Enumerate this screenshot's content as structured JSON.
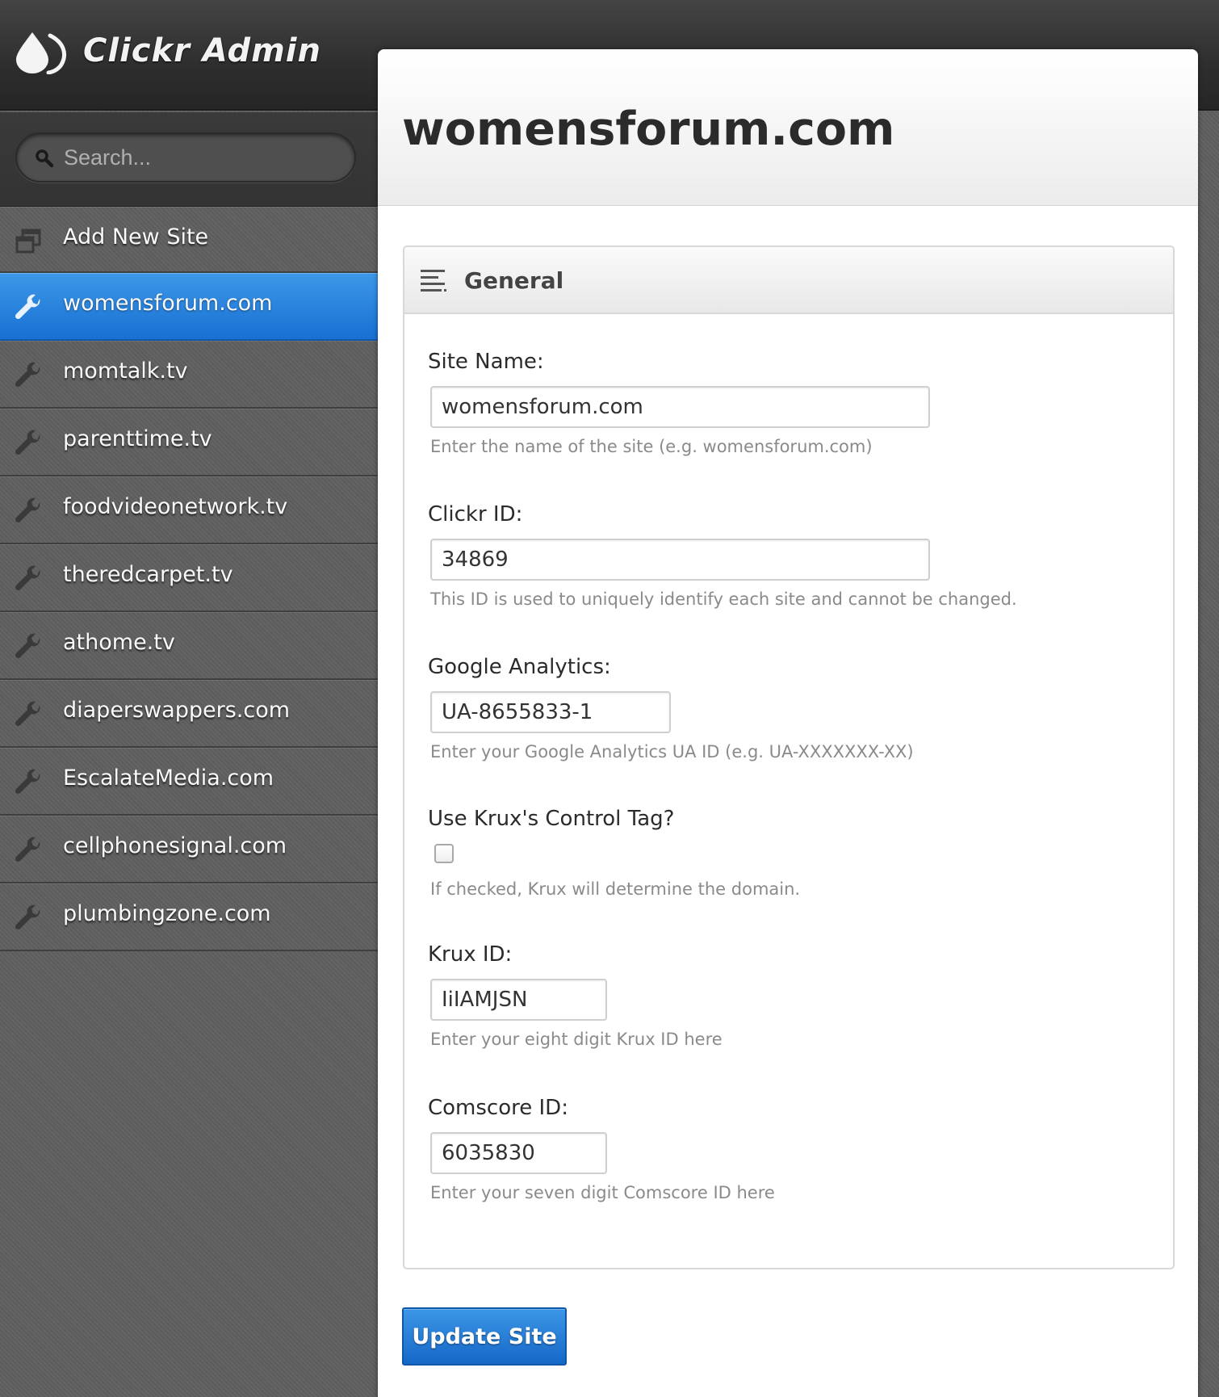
{
  "app": {
    "title": "Clickr Admin",
    "logo_icon": "water-drop-logo-icon"
  },
  "search": {
    "placeholder": "Search...",
    "value": "",
    "icon": "search-icon"
  },
  "sidebar": {
    "add_site": {
      "label": "Add New Site",
      "icon": "add-windows-icon"
    },
    "sites": [
      {
        "label": "womensforum.com",
        "icon": "wrench-icon",
        "active": true
      },
      {
        "label": "momtalk.tv",
        "icon": "wrench-icon",
        "active": false
      },
      {
        "label": "parenttime.tv",
        "icon": "wrench-icon",
        "active": false
      },
      {
        "label": "foodvideonetwork.tv",
        "icon": "wrench-icon",
        "active": false
      },
      {
        "label": "theredcarpet.tv",
        "icon": "wrench-icon",
        "active": false
      },
      {
        "label": "athome.tv",
        "icon": "wrench-icon",
        "active": false
      },
      {
        "label": "diaperswappers.com",
        "icon": "wrench-icon",
        "active": false
      },
      {
        "label": "EscalateMedia.com",
        "icon": "wrench-icon",
        "active": false
      },
      {
        "label": "cellphonesignal.com",
        "icon": "wrench-icon",
        "active": false
      },
      {
        "label": "plumbingzone.com",
        "icon": "wrench-icon",
        "active": false
      }
    ]
  },
  "main": {
    "page_title": "womensforum.com",
    "section": {
      "title": "General",
      "icon": "align-left-lines-icon",
      "fields": {
        "site_name": {
          "label": "Site Name:",
          "value": "womensforum.com",
          "help": "Enter the name of the site (e.g. womensforum.com)"
        },
        "clickr_id": {
          "label": "Clickr ID:",
          "value": "34869",
          "help": "This ID is used to uniquely identify each site and cannot be changed."
        },
        "google_analytics": {
          "label": "Google Analytics:",
          "value": "UA-8655833-1",
          "help": "Enter your Google Analytics UA ID (e.g. UA-XXXXXXX-XX)"
        },
        "krux_control_tag": {
          "label": "Use Krux's Control Tag?",
          "checked": false,
          "help": "If checked, Krux will determine the domain."
        },
        "krux_id": {
          "label": "Krux ID:",
          "value": "IiIAMJSN",
          "help": "Enter your eight digit Krux ID here"
        },
        "comscore_id": {
          "label": "Comscore ID:",
          "value": "6035830",
          "help": "Enter your seven digit Comscore ID here"
        }
      }
    },
    "submit_label": "Update Site"
  },
  "colors": {
    "accent": "#1f7ad8",
    "sidebar_bg": "#5f5f5f",
    "header_bg": "#2e2e2e",
    "help_text": "#8a8a8a"
  }
}
